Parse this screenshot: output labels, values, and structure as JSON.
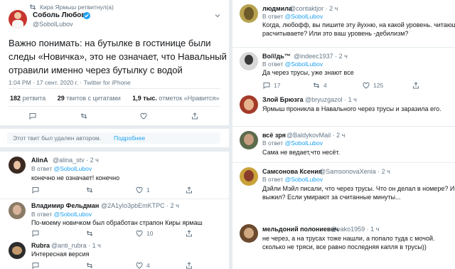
{
  "left": {
    "retweet_line": "Кира Ярмыш ретвитнул(а)",
    "main_tweet": {
      "name": "Соболь Любовь",
      "handle": "@SobolLubov",
      "text_lines": [
        "Важно понимать: на бутылке в гостинице были",
        "следы «Новичка», это не означает, что Навальный",
        "отравили именно через бутылку с водой"
      ],
      "timestamp": "1:04 PM · 17 сент. 2020 г. · Twitter for iPhone",
      "retweets_num": "182",
      "retweets_label": "ретвита",
      "quotes_num": "29",
      "quotes_label": "твитов с цитатами",
      "likes_num": "1,9 тыс.",
      "likes_label": "отметок «Нравится»"
    },
    "deleted_notice": "Этот твит был удален автором.",
    "deleted_link": "Подробнее",
    "replies": [
      {
        "name": "AlinA",
        "handle": "@alina_stv · 2 ч",
        "in_reply": "В ответ",
        "reply_to": "@SobolLubov",
        "text": "конечно не означает! конечно",
        "count_comments": "",
        "count_retweets": "",
        "count_likes": "1"
      },
      {
        "name": "Владимир Фельдман",
        "handle": "@2A1yIo3pbEmKTPC · 2 ч",
        "in_reply": "В ответ",
        "reply_to": "@SobolLubov",
        "text": "По-моему новичком был обработан страпон Киры ярмаш",
        "count_comments": "",
        "count_retweets": "",
        "count_likes": "10"
      },
      {
        "name": "Rubra",
        "handle": "@anti_rubra · 1 ч",
        "in_reply": "",
        "reply_to": "",
        "text": "Интересная версия",
        "count_comments": "",
        "count_retweets": "",
        "count_likes": "4"
      }
    ]
  },
  "right": {
    "replies": [
      {
        "name": "людмила",
        "handle": "@contaktjor · 2 ч",
        "in_reply": "В ответ",
        "reply_to": "@SobolLubov",
        "lines": [
          "Когда, любофф, вы пишите эту йухню, на какой уровень. читающих вы",
          "расчитываете? Или это ваш уровень -дебилизм?"
        ],
        "count_comments": "",
        "count_retweets": "",
        "count_likes": ""
      },
      {
        "name": "Bo///дь™",
        "handle": "@indeec1937 · 2 ч",
        "in_reply": "В ответ",
        "reply_to": "@SobolLubov",
        "lines": [
          "Да через трусы, уже знают все"
        ],
        "count_comments": "17",
        "count_retweets": "4",
        "count_likes": "125"
      },
      {
        "name": "Злой Брюзга",
        "handle": "@bryuzgazol · 1 ч",
        "in_reply": "",
        "reply_to": "",
        "lines": [
          "Ярмыш проникла в Навального через трусы и заразила его."
        ],
        "count_comments": "",
        "count_retweets": "",
        "count_likes": ""
      },
      {
        "name": "всё зря",
        "handle": "@BaldykovMail · 2 ч",
        "in_reply": "В ответ",
        "reply_to": "@SobolLubov",
        "lines": [
          "Сама не ведает,что несёт."
        ],
        "count_comments": "",
        "count_retweets": "",
        "count_likes": ""
      },
      {
        "name": "Самсонова Ксения",
        "handle": "@SamsonovaXenia · 2 ч",
        "in_reply": "В ответ",
        "reply_to": "@SobolLubov",
        "lines": [
          "Дэйли Мэйл писали, что через трусы. Что он делал в номере? И как",
          "выжил? Если умирают за считанные минуты..."
        ],
        "count_comments": "",
        "count_retweets": "",
        "count_likes": ""
      },
      {
        "name": "мельдоний полониевич",
        "handle": "@vako1959 · 1 ч",
        "in_reply": "",
        "reply_to": "",
        "lines": [
          "не через, а на трусах тоже нашли, а попало туда с мочой.",
          "сколько не  тряси, все равно последняя капля в трусы))"
        ],
        "count_comments": "",
        "count_retweets": "",
        "count_likes": ""
      }
    ]
  },
  "icons": {
    "retweet": "retweet-icon",
    "comment": "comment-icon",
    "like": "heart-icon",
    "share": "share-icon",
    "verified": "verified-badge-icon",
    "more": "more-icon"
  },
  "colors": {
    "accent": "#1da1f2",
    "muted": "#657786",
    "background": "#e6ecf0",
    "text": "#14171a"
  }
}
